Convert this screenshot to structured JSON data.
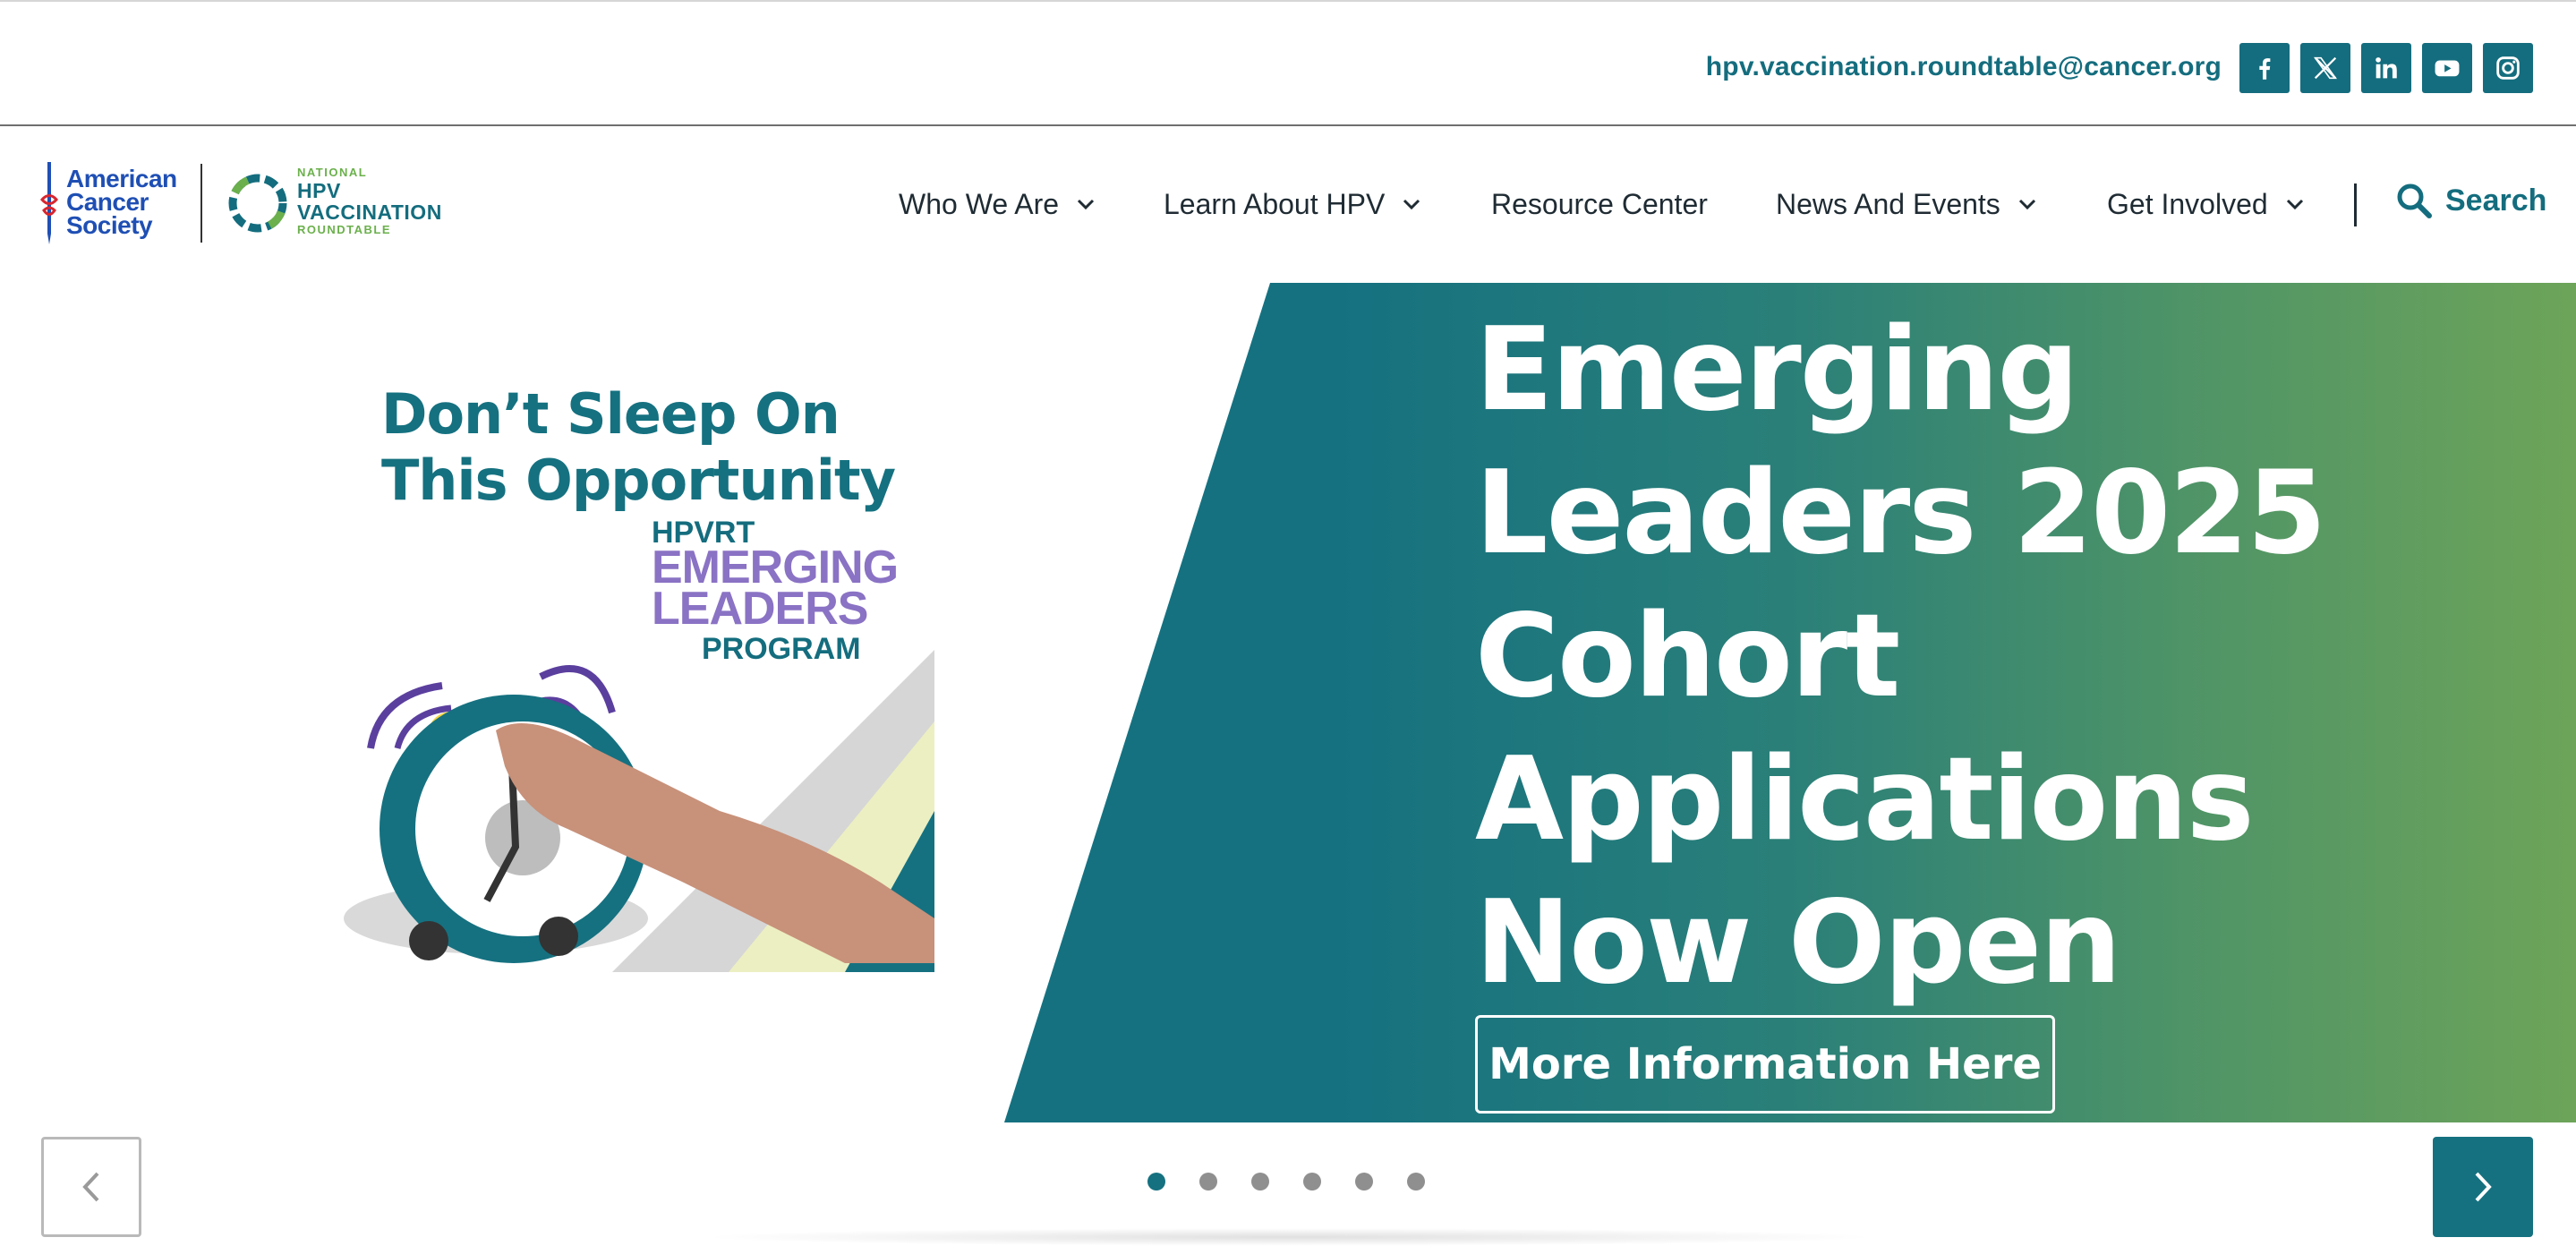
{
  "topbar": {
    "email": "hpv.vaccination.roundtable@cancer.org",
    "social": [
      "facebook-icon",
      "x-icon",
      "linkedin-icon",
      "youtube-icon",
      "instagram-icon"
    ]
  },
  "header": {
    "acs_logo": {
      "line1": "American",
      "line2": "Cancer",
      "line3": "Society"
    },
    "hpv_logo": {
      "line1": "NATIONAL",
      "line2": "HPV",
      "line3": "VACCINATION",
      "line4": "ROUNDTABLE"
    },
    "nav": [
      {
        "label": "Who We Are",
        "has_dropdown": true
      },
      {
        "label": "Learn About HPV",
        "has_dropdown": true
      },
      {
        "label": "Resource Center",
        "has_dropdown": false
      },
      {
        "label": "News And Events",
        "has_dropdown": true
      },
      {
        "label": "Get Involved",
        "has_dropdown": true
      }
    ],
    "search_label": "Search"
  },
  "hero": {
    "title_lines": [
      "Emerging",
      "Leaders 2025",
      "Cohort",
      "Applications",
      "Now Open"
    ],
    "button_label": "More Information Here",
    "promo": {
      "headline_line1": "Don’t Sleep On",
      "headline_line2": "This Opportunity",
      "badge_line1": "HPVRT",
      "badge_line2": "EMERGING",
      "badge_line3": "LEADERS",
      "badge_line4": "PROGRAM"
    }
  },
  "slider": {
    "slide_count": 6,
    "active_index": 0
  },
  "colors": {
    "brand_teal": "#157180",
    "brand_green": "#6da459",
    "acs_blue": "#1f4fb4"
  }
}
